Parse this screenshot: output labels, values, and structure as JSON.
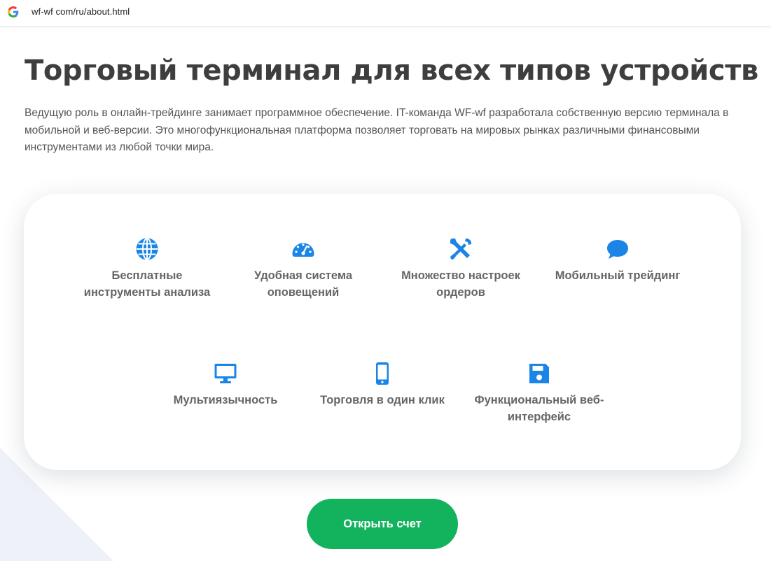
{
  "browser": {
    "url": "wf-wf com/ru/about.html",
    "favicon": "google-g-icon"
  },
  "header": {
    "title": "Торговый терминал для всех типов устройств",
    "intro": "Ведущую роль в онлайн-трейдинге занимает программное обеспечение. IT-команда WF-wf разработала собственную версию терминала в мобильной и веб-версии. Это многофункциональная платформа позволяет торговать на мировых рынках различными финансовыми инструментами из любой точки мира."
  },
  "features": [
    {
      "icon": "globe-icon",
      "label": "Бесплатные инструменты анализа"
    },
    {
      "icon": "speedometer-icon",
      "label": "Удобная система оповещений"
    },
    {
      "icon": "tools-icon",
      "label": "Множество настроек ордеров"
    },
    {
      "icon": "chat-bubble-icon",
      "label": "Мобильный трейдинг"
    },
    {
      "icon": "desktop-icon",
      "label": "Мультиязычность"
    },
    {
      "icon": "smartphone-icon",
      "label": "Торговля в один клик"
    },
    {
      "icon": "floppy-disk-icon",
      "label": "Функциональный веб-интерфейс"
    }
  ],
  "cta": {
    "label": "Открыть счет"
  },
  "colors": {
    "accent_blue": "#1a85e6",
    "cta_green": "#13b35d",
    "title_text": "#3e3e3e",
    "body_text": "#555555",
    "feature_text": "#666666"
  }
}
